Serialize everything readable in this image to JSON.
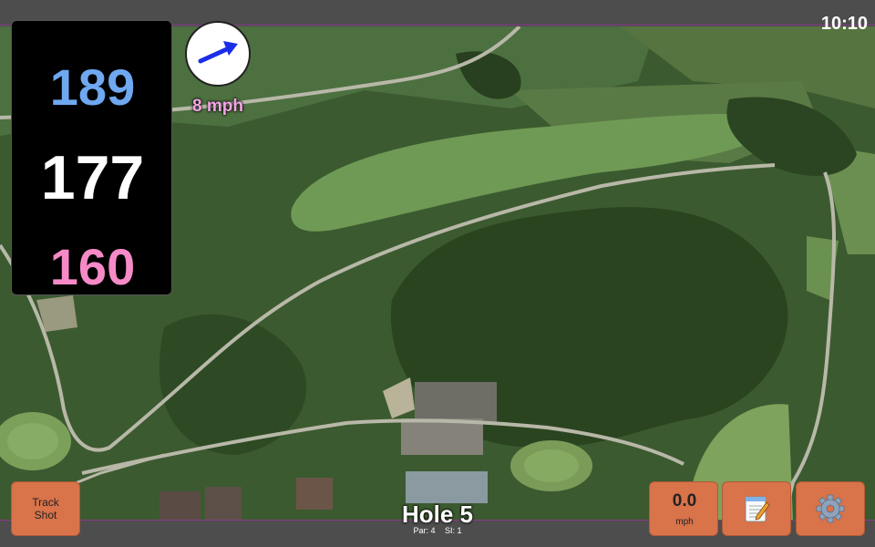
{
  "status": {
    "time": "10:10"
  },
  "yardages": {
    "back": "189",
    "middle": "177",
    "front": "160"
  },
  "wind": {
    "speed": "8 mph",
    "icon": "wind-direction-arrow-icon"
  },
  "hole": {
    "title": "Hole 5",
    "par": "Par: 4",
    "si": "SI: 1"
  },
  "buttons": {
    "track_shot_line1": "Track",
    "track_shot_line2": "Shot",
    "speed_value": "0.0",
    "speed_unit": "mph",
    "notes_icon": "notepad-icon",
    "settings_icon": "gear-icon"
  },
  "colors": {
    "back": "#6fa8f0",
    "middle": "#ffffff",
    "front": "#f58ac6",
    "wind_speed": "#f3a4e4",
    "button": "#d8734a"
  }
}
